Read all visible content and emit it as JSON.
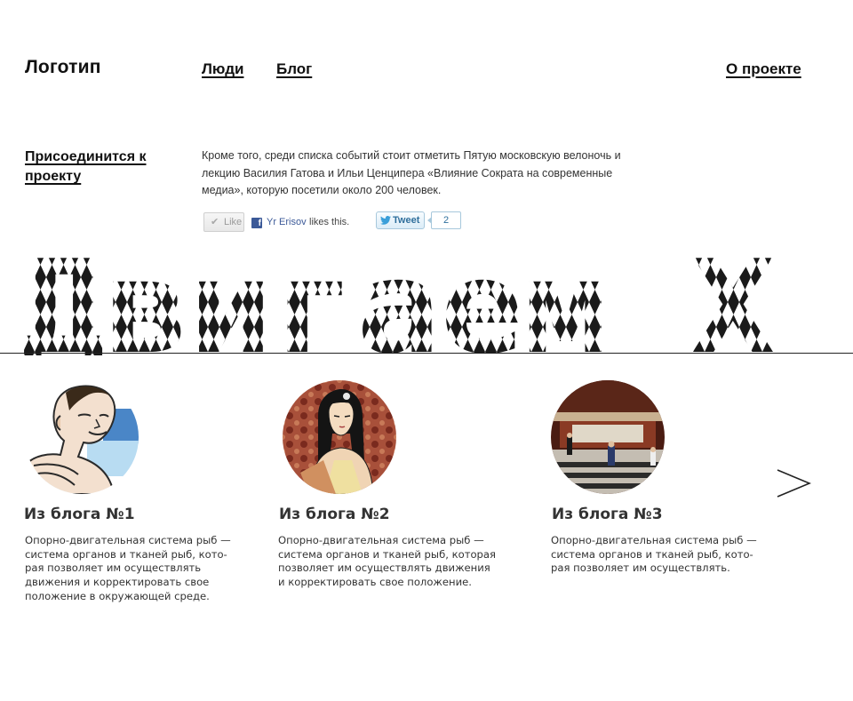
{
  "header": {
    "logo": "Логотип",
    "nav": [
      {
        "label": "Люди"
      },
      {
        "label": "Блог"
      },
      {
        "label": "О проекте"
      }
    ]
  },
  "join": {
    "label": "Присоединится к проекту"
  },
  "intro": {
    "text": "Кроме того, среди списка событий стоит отметить Пятую московскую велоночь и лекцию Василия Гатова и Ильи Ценципера «Влияние Сократа на современные медиа», которую посетили около 200 человек."
  },
  "social": {
    "like_label": "Like",
    "liker_name": "Yr Erisov",
    "likes_text": "likes this.",
    "tweet_label": "Tweet",
    "tweet_count": "2"
  },
  "banner": {
    "title": "Двигаем Х"
  },
  "blog": {
    "cards": [
      {
        "title": "Из блога №1",
        "text": "Опорно-двигательная система рыб —\nсистема органов и тканей рыб, кото-\nрая позволяет им осуществлять\nдвижения и корректировать свое\nположение в окружающей среде."
      },
      {
        "title": "Из блога №2",
        "text": "Опорно-двигательная система рыб —\nсистема органов и тканей рыб, которая\nпозволяет им осуществлять движения\nи корректировать свое положение."
      },
      {
        "title": "Из блога №3",
        "text": "Опорно-двигательная система рыб —\nсистема органов и тканей рыб, кото-\nрая позволяет им осуществлять."
      }
    ],
    "next_icon": "chevron-right-icon"
  },
  "colors": {
    "text": "#222222",
    "facebook": "#3b5998",
    "twitter": "#2f6f9c",
    "banner": "#1a1a1a"
  }
}
